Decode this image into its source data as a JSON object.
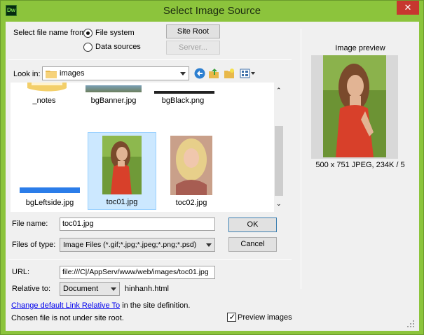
{
  "window": {
    "title": "Select Image Source",
    "app_icon": "Dw",
    "close_glyph": "✕"
  },
  "select_from": {
    "label": "Select file name from:",
    "options": [
      "File system",
      "Data sources"
    ],
    "selected": "File system"
  },
  "buttons": {
    "site_root": "Site Root",
    "server": "Server...",
    "ok": "OK",
    "cancel": "Cancel"
  },
  "look_in": {
    "label": "Look in:",
    "value": "images"
  },
  "files": [
    {
      "name": "_notes",
      "kind": "folder"
    },
    {
      "name": "bgBanner.jpg",
      "kind": "image"
    },
    {
      "name": "bgBlack.png",
      "kind": "image"
    },
    {
      "name": "bgLeftside.jpg",
      "kind": "image"
    },
    {
      "name": "toc01.jpg",
      "kind": "image",
      "selected": true
    },
    {
      "name": "toc02.jpg",
      "kind": "image"
    }
  ],
  "file_name": {
    "label": "File name:",
    "value": "toc01.jpg"
  },
  "files_of_type": {
    "label": "Files of type:",
    "value": "Image Files (*.gif;*.jpg;*.jpeg;*.png;*.psd)"
  },
  "url": {
    "label": "URL:",
    "value": "file:///C|/AppServ/www/web/images/toc01.jpg"
  },
  "relative_to": {
    "label": "Relative to:",
    "value": "Document",
    "page": "hinhanh.html"
  },
  "link_row": {
    "link": "Change default Link Relative To",
    "suffix": "in the site definition."
  },
  "status": "Chosen file is not under site root.",
  "preview": {
    "title": "Image preview",
    "info": "500 x 751 JPEG, 234K / 5",
    "checkbox_label": "Preview images",
    "checked": true
  },
  "icons": [
    "folder-icon",
    "back-icon",
    "up-folder-icon",
    "new-folder-icon",
    "view-menu-icon",
    "close-icon"
  ],
  "colors": {
    "window_frame": "#8cc43c",
    "selection": "#cce8ff",
    "close_button": "#c7372f"
  }
}
